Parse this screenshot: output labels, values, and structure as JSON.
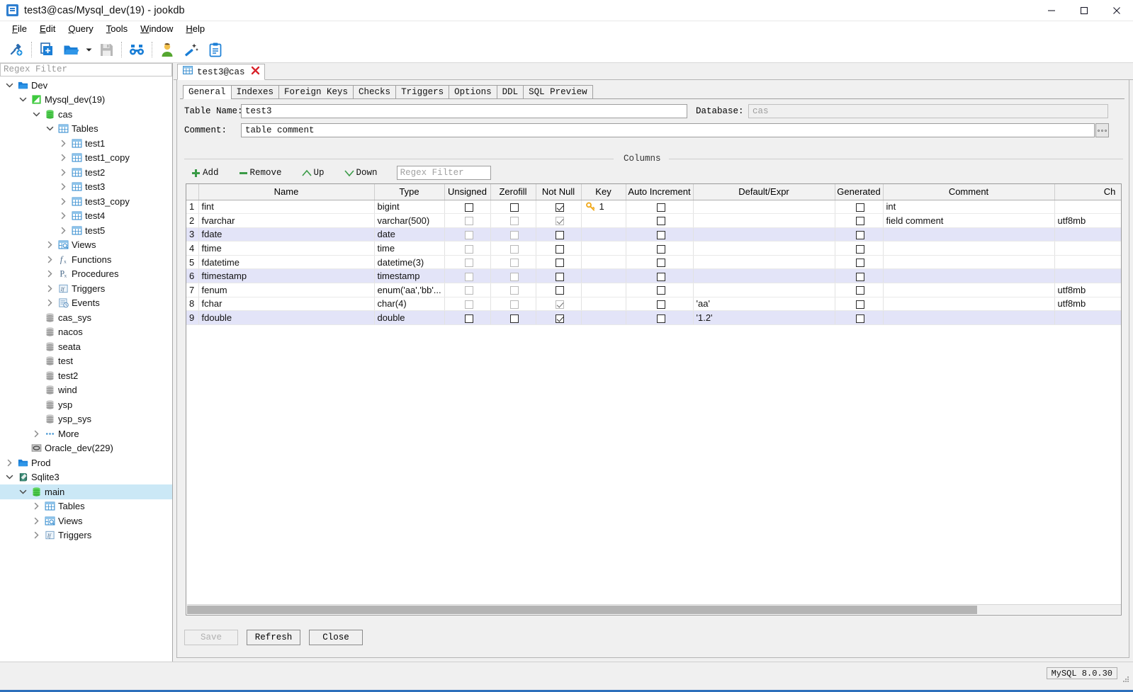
{
  "window": {
    "title": "test3@cas/Mysql_dev(19) - jookdb",
    "app_icon": "database-app-icon",
    "minimize": "minimize-icon",
    "maximize": "maximize-icon",
    "close": "close-icon"
  },
  "menubar": {
    "items": [
      {
        "label": "File",
        "mnemonic": "F"
      },
      {
        "label": "Edit",
        "mnemonic": "E"
      },
      {
        "label": "Query",
        "mnemonic": "Q"
      },
      {
        "label": "Tools",
        "mnemonic": "T"
      },
      {
        "label": "Window",
        "mnemonic": "W"
      },
      {
        "label": "Help",
        "mnemonic": "H"
      }
    ]
  },
  "toolbar": {
    "buttons": [
      {
        "name": "new-connection-icon",
        "title": "New Connection"
      },
      {
        "name": "new-query-icon",
        "title": "New Query"
      },
      {
        "name": "open-folder-icon",
        "title": "Open"
      },
      {
        "name": "open-dropdown-icon",
        "title": "Open Recent"
      },
      {
        "name": "save-icon",
        "title": "Save"
      },
      {
        "name": "find-icon",
        "title": "Find"
      },
      {
        "name": "user-icon",
        "title": "Users"
      },
      {
        "name": "magic-wand-icon",
        "title": "Tools"
      },
      {
        "name": "clipboard-icon",
        "title": "Notes"
      }
    ]
  },
  "sidebar": {
    "filter_placeholder": "Regex Filter",
    "tree": [
      {
        "label": "Dev",
        "depth": 0,
        "icon": "folder-icon",
        "twisty": "down"
      },
      {
        "label": "Mysql_dev(19)",
        "depth": 1,
        "icon": "mysql-icon",
        "twisty": "down"
      },
      {
        "label": "cas",
        "depth": 2,
        "icon": "database-green-icon",
        "twisty": "down"
      },
      {
        "label": "Tables",
        "depth": 3,
        "icon": "table-icon",
        "twisty": "down"
      },
      {
        "label": "test1",
        "depth": 4,
        "icon": "table-icon",
        "twisty": "right"
      },
      {
        "label": "test1_copy",
        "depth": 4,
        "icon": "table-icon",
        "twisty": "right"
      },
      {
        "label": "test2",
        "depth": 4,
        "icon": "table-icon",
        "twisty": "right"
      },
      {
        "label": "test3",
        "depth": 4,
        "icon": "table-icon",
        "twisty": "right"
      },
      {
        "label": "test3_copy",
        "depth": 4,
        "icon": "table-icon",
        "twisty": "right"
      },
      {
        "label": "test4",
        "depth": 4,
        "icon": "table-icon",
        "twisty": "right"
      },
      {
        "label": "test5",
        "depth": 4,
        "icon": "table-icon",
        "twisty": "right"
      },
      {
        "label": "Views",
        "depth": 3,
        "icon": "views-icon",
        "twisty": "right"
      },
      {
        "label": "Functions",
        "depth": 3,
        "icon": "function-icon",
        "twisty": "right"
      },
      {
        "label": "Procedures",
        "depth": 3,
        "icon": "procedure-icon",
        "twisty": "right"
      },
      {
        "label": "Triggers",
        "depth": 3,
        "icon": "trigger-icon",
        "twisty": "right"
      },
      {
        "label": "Events",
        "depth": 3,
        "icon": "event-icon",
        "twisty": "right"
      },
      {
        "label": "cas_sys",
        "depth": 2,
        "icon": "database-grey-icon",
        "twisty": "none"
      },
      {
        "label": "nacos",
        "depth": 2,
        "icon": "database-grey-icon",
        "twisty": "none"
      },
      {
        "label": "seata",
        "depth": 2,
        "icon": "database-grey-icon",
        "twisty": "none"
      },
      {
        "label": "test",
        "depth": 2,
        "icon": "database-grey-icon",
        "twisty": "none"
      },
      {
        "label": "test2",
        "depth": 2,
        "icon": "database-grey-icon",
        "twisty": "none"
      },
      {
        "label": "wind",
        "depth": 2,
        "icon": "database-grey-icon",
        "twisty": "none"
      },
      {
        "label": "ysp",
        "depth": 2,
        "icon": "database-grey-icon",
        "twisty": "none"
      },
      {
        "label": "ysp_sys",
        "depth": 2,
        "icon": "database-grey-icon",
        "twisty": "none"
      },
      {
        "label": "More",
        "depth": 2,
        "icon": "more-icon",
        "twisty": "right"
      },
      {
        "label": "Oracle_dev(229)",
        "depth": 1,
        "icon": "oracle-icon",
        "twisty": "none"
      },
      {
        "label": "Prod",
        "depth": 0,
        "icon": "folder-icon",
        "twisty": "right"
      },
      {
        "label": "Sqlite3",
        "depth": 0,
        "icon": "sqlite-icon",
        "twisty": "down"
      },
      {
        "label": "main",
        "depth": 1,
        "icon": "database-green-icon",
        "twisty": "down",
        "selected": true
      },
      {
        "label": "Tables",
        "depth": 2,
        "icon": "table-icon",
        "twisty": "right"
      },
      {
        "label": "Views",
        "depth": 2,
        "icon": "views-icon",
        "twisty": "right"
      },
      {
        "label": "Triggers",
        "depth": 2,
        "icon": "trigger-icon",
        "twisty": "right"
      }
    ]
  },
  "doc_tab": {
    "label": "test3@cas",
    "icon": "table-icon",
    "close": "close-tab-icon"
  },
  "subtabs": [
    {
      "label": "General",
      "active": true
    },
    {
      "label": "Indexes",
      "active": false
    },
    {
      "label": "Foreign Keys",
      "active": false
    },
    {
      "label": "Checks",
      "active": false
    },
    {
      "label": "Triggers",
      "active": false
    },
    {
      "label": "Options",
      "active": false
    },
    {
      "label": "DDL",
      "active": false
    },
    {
      "label": "SQL Preview",
      "active": false
    }
  ],
  "form": {
    "table_name_label": "Table Name:",
    "table_name_value": "test3",
    "database_label": "Database:",
    "database_value": "cas",
    "comment_label": "Comment:",
    "comment_value": "table comment",
    "comment_more": "ellipsis-button"
  },
  "columns_group": {
    "title": "Columns",
    "add": "Add",
    "remove": "Remove",
    "up": "Up",
    "down": "Down",
    "filter_placeholder": "Regex Filter"
  },
  "grid": {
    "headers": [
      "",
      "Name",
      "Type",
      "Unsigned",
      "Zerofill",
      "Not Null",
      "Key",
      "Auto Increment",
      "Default/Expr",
      "Generated",
      "Comment",
      "Ch"
    ],
    "rows": [
      {
        "n": "1",
        "name": "fint",
        "type": "bigint",
        "unsigned": "off",
        "zerofill": "off",
        "notnull": "on",
        "key": "1",
        "autoinc": "off",
        "default": "",
        "generated": "off",
        "comment": "int",
        "charset": ""
      },
      {
        "n": "2",
        "name": "fvarchar",
        "type": "varchar(500)",
        "unsigned": "dim",
        "zerofill": "dim",
        "notnull": "dimon",
        "key": "",
        "autoinc": "off",
        "default": "",
        "generated": "off",
        "comment": "field comment",
        "charset": "utf8mb"
      },
      {
        "n": "3",
        "name": "fdate",
        "type": "date",
        "unsigned": "dim",
        "zerofill": "dim",
        "notnull": "off",
        "key": "",
        "autoinc": "off",
        "default": "",
        "generated": "off",
        "comment": "",
        "charset": "",
        "alt": true
      },
      {
        "n": "4",
        "name": "ftime",
        "type": "time",
        "unsigned": "dim",
        "zerofill": "dim",
        "notnull": "off",
        "key": "",
        "autoinc": "off",
        "default": "",
        "generated": "off",
        "comment": "",
        "charset": ""
      },
      {
        "n": "5",
        "name": "fdatetime",
        "type": "datetime(3)",
        "unsigned": "dim",
        "zerofill": "dim",
        "notnull": "off",
        "key": "",
        "autoinc": "off",
        "default": "",
        "generated": "off",
        "comment": "",
        "charset": ""
      },
      {
        "n": "6",
        "name": "ftimestamp",
        "type": "timestamp",
        "unsigned": "dim",
        "zerofill": "dim",
        "notnull": "off",
        "key": "",
        "autoinc": "off",
        "default": "",
        "generated": "off",
        "comment": "",
        "charset": "",
        "alt": true
      },
      {
        "n": "7",
        "name": "fenum",
        "type": "enum('aa','bb'...",
        "unsigned": "dim",
        "zerofill": "dim",
        "notnull": "off",
        "key": "",
        "autoinc": "off",
        "default": "",
        "generated": "off",
        "comment": "",
        "charset": "utf8mb"
      },
      {
        "n": "8",
        "name": "fchar",
        "type": "char(4)",
        "unsigned": "dim",
        "zerofill": "dim",
        "notnull": "dimon",
        "key": "",
        "autoinc": "off",
        "default": "'aa'",
        "generated": "off",
        "comment": "",
        "charset": "utf8mb"
      },
      {
        "n": "9",
        "name": "fdouble",
        "type": "double",
        "unsigned": "off",
        "zerofill": "off",
        "notnull": "on",
        "key": "",
        "autoinc": "off",
        "default": "'1.2'",
        "generated": "off",
        "comment": "",
        "charset": "",
        "alt": true
      }
    ]
  },
  "buttons": {
    "save": "Save",
    "refresh": "Refresh",
    "close": "Close"
  },
  "statusbar": {
    "engine": "MySQL 8.0.30"
  },
  "colors": {
    "accent": "#2c6fbb",
    "selection": "#cbe8f6",
    "alt_row": "#e3e4f8",
    "key_gold": "#f0a91b",
    "add_green": "#3a9b47"
  }
}
